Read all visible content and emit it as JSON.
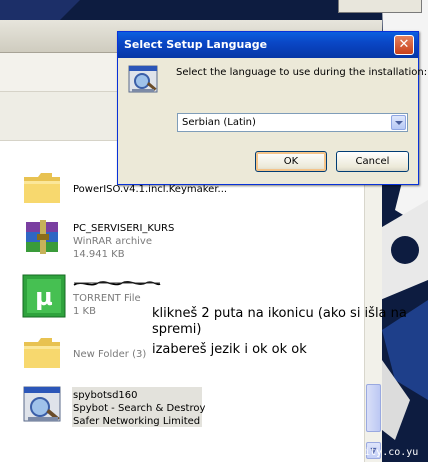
{
  "dialog": {
    "title": "Select Setup Language",
    "close_glyph": "✕",
    "message": "Select the language to use during the installation:",
    "language_selected": "Serbian (Latin)",
    "ok_label": "OK",
    "cancel_label": "Cancel"
  },
  "files": [
    {
      "name": "PowerISO.v4.1.incl.Keymaker...",
      "icon": "folder-icon"
    },
    {
      "name": "PC_SERVISERI_KURS",
      "type": "WinRAR archive",
      "size": "14.941 KB",
      "icon": "winrar-archive-icon"
    },
    {
      "name": "TORRENT File",
      "size": "1 KB",
      "icon": "utorrent-icon"
    },
    {
      "name": "New Folder (3)",
      "icon": "folder-icon"
    },
    {
      "name": "spybotsd160",
      "type": "Spybot - Search & Destroy",
      "company": "Safer Networking Limited",
      "icon": "spybot-installer-icon"
    }
  ],
  "annotation": {
    "line1": "klikneš 2 puta na ikonicu (ako si išla na",
    "line2": "spremi)",
    "line3": "izabereš jezik  i ok ok ok"
  },
  "watermark": "www.mycity.co.yu",
  "colors": {
    "dialog_title": "#0a47c6",
    "dialog_body": "#ece9d8",
    "background": "#0b1a3a"
  }
}
